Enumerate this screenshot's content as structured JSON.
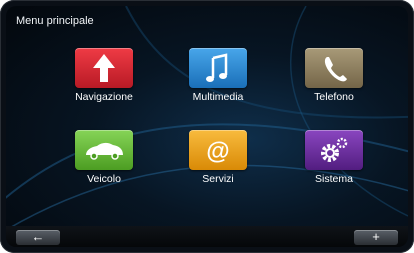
{
  "header": {
    "title": "Menu principale"
  },
  "tiles": [
    {
      "label": "Navigazione",
      "icon": "navigation-arrow-icon",
      "color": "#d8232f"
    },
    {
      "label": "Multimedia",
      "icon": "music-note-icon",
      "color": "#2a8bd6"
    },
    {
      "label": "Telefono",
      "icon": "phone-icon",
      "color": "#8f8060"
    },
    {
      "label": "Veicolo",
      "icon": "car-icon",
      "color": "#6bbf3a"
    },
    {
      "label": "Servizi",
      "icon": "at-sign-icon",
      "color": "#f0a11a"
    },
    {
      "label": "Sistema",
      "icon": "gears-icon",
      "color": "#6a2c9a"
    }
  ],
  "footer": {
    "back_glyph": "←",
    "add_glyph": "+"
  }
}
